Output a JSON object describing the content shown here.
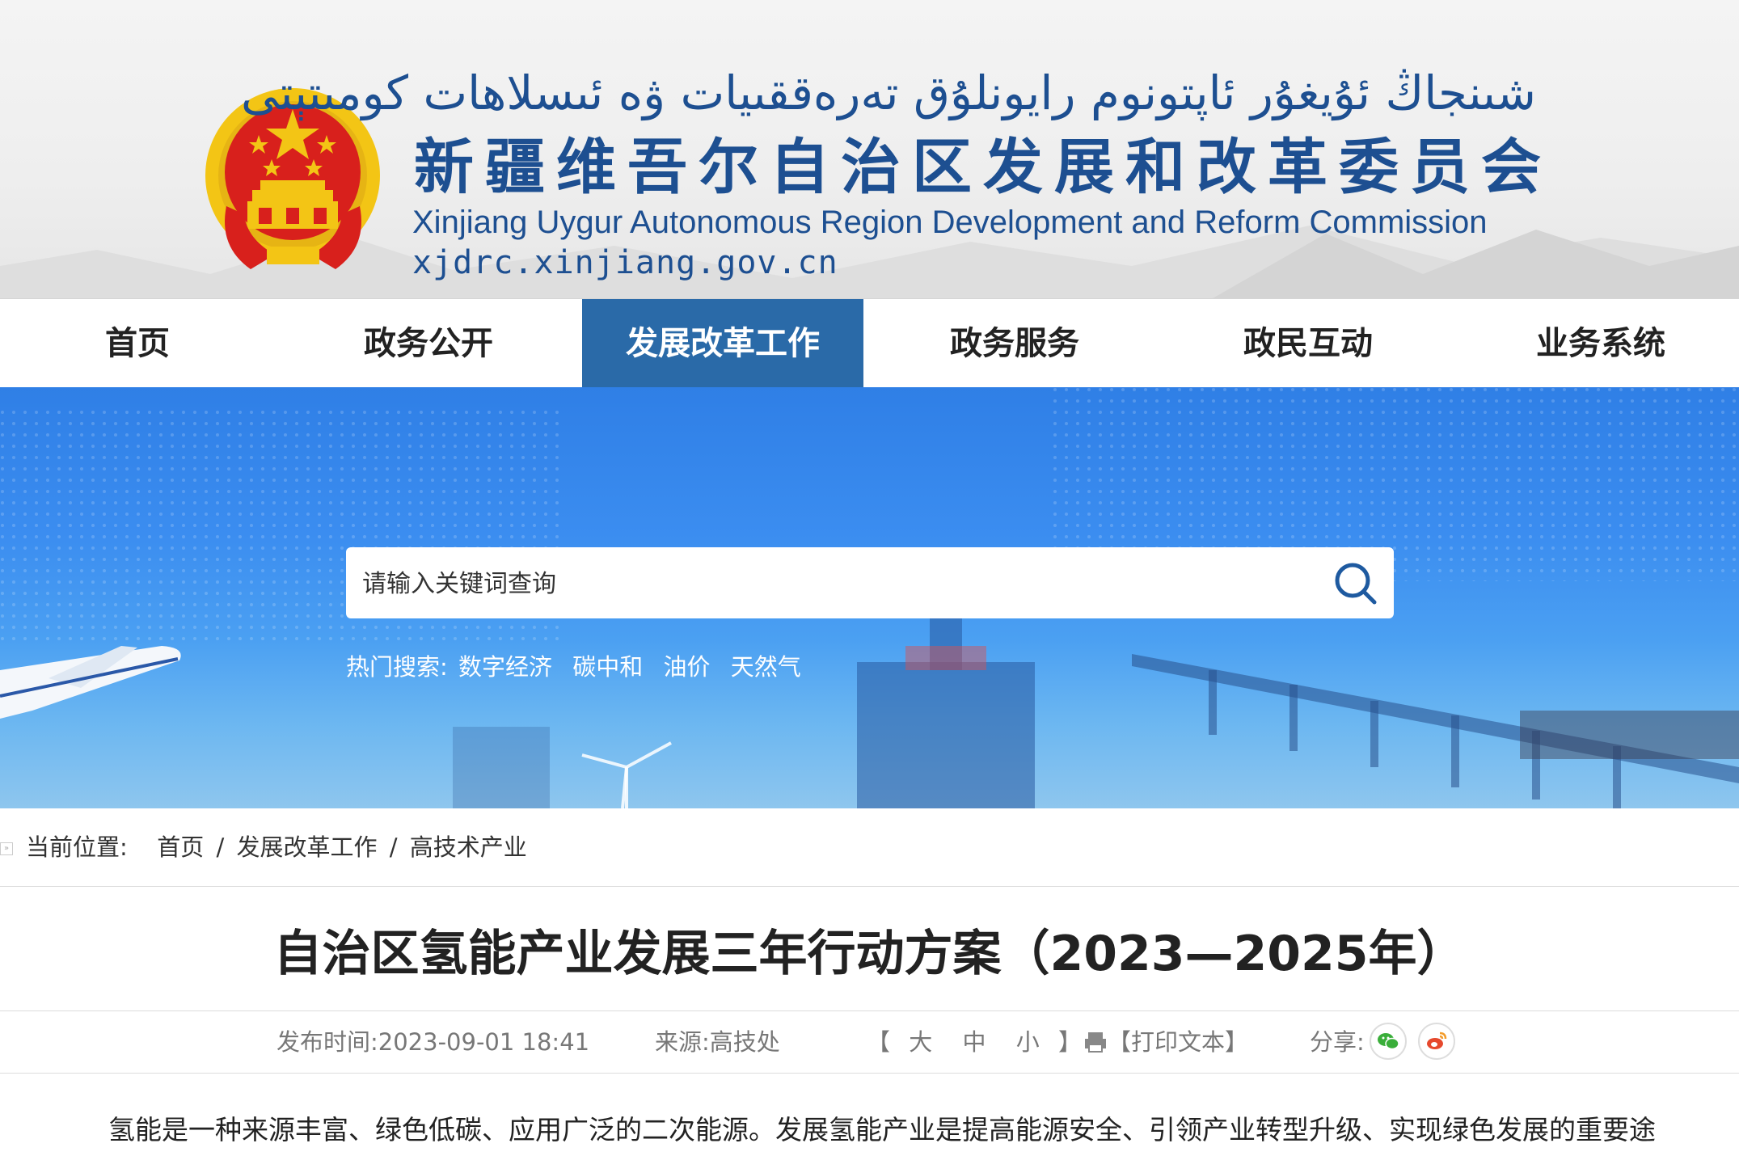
{
  "header": {
    "uyghur_title": "شىنجاڭ ئۇيغۇر ئاپتونوم رايونلۇق تەرەققىيات ۋە ئىسلاھات كومىتېتى",
    "cn_title": "新疆维吾尔自治区发展和改革委员会",
    "en_title": "Xinjiang Uygur Autonomous Region Development and Reform Commission",
    "domain": "xjdrc.xinjiang.gov.cn"
  },
  "nav": {
    "items": [
      {
        "label": "首页",
        "active": false
      },
      {
        "label": "政务公开",
        "active": false
      },
      {
        "label": "发展改革工作",
        "active": true
      },
      {
        "label": "政务服务",
        "active": false
      },
      {
        "label": "政民互动",
        "active": false
      },
      {
        "label": "业务系统",
        "active": false
      }
    ],
    "active_color": "#2a6aa8"
  },
  "search": {
    "placeholder": "请输入关键词查询",
    "icon": "search-icon",
    "hot_label": "热门搜索:",
    "hot_terms": [
      "数字经济",
      "碳中和",
      "油价",
      "天然气"
    ]
  },
  "breadcrumb": {
    "label": "当前位置:",
    "items": [
      "首页",
      "发展改革工作",
      "高技术产业"
    ],
    "separator": "/"
  },
  "article": {
    "title": "自治区氢能产业发展三年行动方案（2023—2025年）",
    "publish_label": "发布时间:",
    "publish_time": "2023-09-01 18:41",
    "source_label": "来源:",
    "source": "高技处",
    "font_size_open": "【",
    "font_sizes": [
      "大",
      "中",
      "小"
    ],
    "font_size_close": "】",
    "print_label": "【打印文本】",
    "share_label": "分享:",
    "share_icons": [
      "wechat-icon",
      "weibo-icon"
    ],
    "first_paragraph": "氢能是一种来源丰富、绿色低碳、应用广泛的二次能源。发展氢能产业是提高能源安全、引领产业转型升级、实现绿色发展的重要途"
  },
  "colors": {
    "brand_blue": "#1d4f91",
    "banner_blue": "#3b8df0",
    "emblem_red": "#d8201c",
    "emblem_gold": "#f3c515",
    "wechat_green": "#3aae3a",
    "weibo_orange": "#e6492d"
  }
}
